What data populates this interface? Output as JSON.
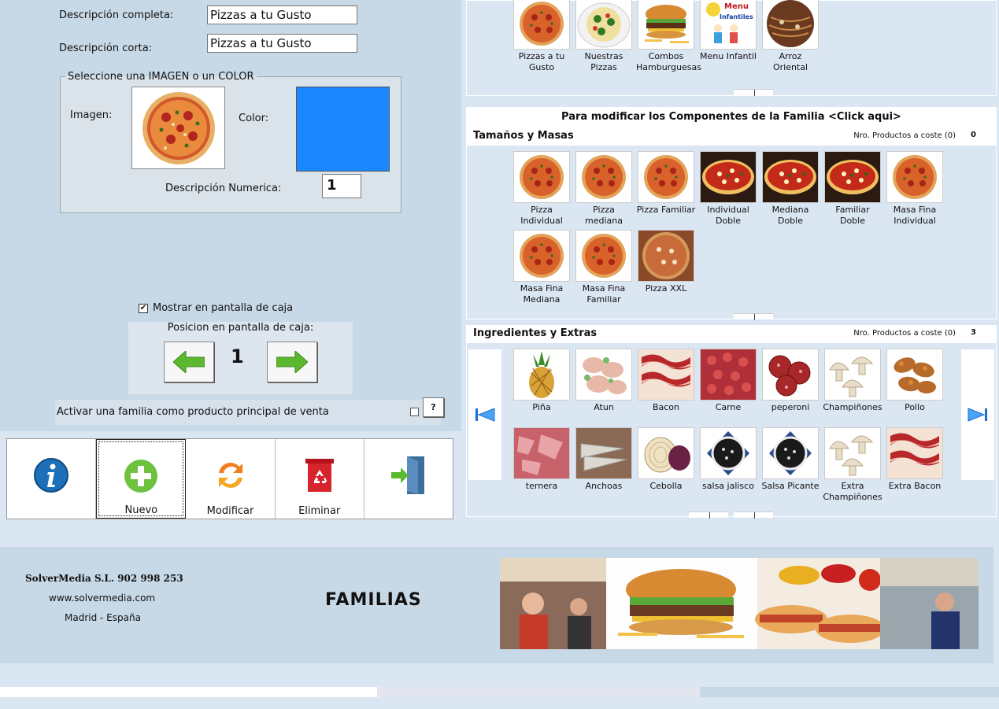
{
  "form": {
    "desc_completa_label": "Descripción completa:",
    "desc_completa_value": "Pizzas a tu Gusto",
    "desc_corta_label": "Descripción corta:",
    "desc_corta_value": "Pizzas a tu Gusto",
    "group_legend": "Seleccione una IMAGEN o un COLOR",
    "imagen_label": "Imagen:",
    "color_label": "Color:",
    "color_value": "#1a86ff",
    "desc_num_label": "Descripción Numerica:",
    "desc_num_value": "1",
    "mostrar_label": "Mostrar en pantalla de caja",
    "mostrar_checked": true,
    "posicion_label": "Posicion en pantalla de caja:",
    "posicion_value": "1",
    "activar_label": "Activar una familia como producto principal de venta",
    "help_label": "?"
  },
  "toolbar": [
    {
      "label": "",
      "icon": "info-icon"
    },
    {
      "label": "Nuevo",
      "icon": "plus-icon"
    },
    {
      "label": "Modificar",
      "icon": "refresh-icon"
    },
    {
      "label": "Eliminar",
      "icon": "recycle-bin-icon"
    },
    {
      "label": "",
      "icon": "exit-door-icon"
    }
  ],
  "families": [
    {
      "label": "Pizzas a tu Gusto",
      "kind": "pizza"
    },
    {
      "label": "Nuestras Pizzas",
      "kind": "pizza-plate"
    },
    {
      "label": "Combos Hamburguesas",
      "kind": "burger"
    },
    {
      "label": "Menu Infantil",
      "kind": "kids"
    },
    {
      "label": "Arroz Oriental",
      "kind": "noodles"
    }
  ],
  "components_bar": "Para modificar los Componentes de la Familia <Click aqui>",
  "sizes_section": {
    "title": "Tamaños y Masas",
    "count_label": "Nro. Productos a coste (0)",
    "count_value": "0",
    "items": [
      {
        "label": "Pizza Individual",
        "kind": "pizza"
      },
      {
        "label": "Pizza mediana",
        "kind": "pizza"
      },
      {
        "label": "Pizza Familiar",
        "kind": "pizza"
      },
      {
        "label": "Individual Doble",
        "kind": "pizza-red"
      },
      {
        "label": "Mediana Doble",
        "kind": "pizza-red"
      },
      {
        "label": "Familiar Doble",
        "kind": "pizza-red"
      },
      {
        "label": "Masa Fina Individual",
        "kind": "pizza"
      },
      {
        "label": "Masa Fina Mediana",
        "kind": "pizza"
      },
      {
        "label": "Masa Fina Familiar",
        "kind": "pizza"
      },
      {
        "label": "Pizza XXL",
        "kind": "pizza-xxl"
      }
    ]
  },
  "extras_section": {
    "title": "Ingredientes y Extras",
    "count_label": "Nro. Productos a coste (0)",
    "count_value": "3",
    "items": [
      {
        "label": "Piña",
        "kind": "pineapple"
      },
      {
        "label": "Atun",
        "kind": "tuna"
      },
      {
        "label": "Bacon",
        "kind": "bacon"
      },
      {
        "label": "Carne",
        "kind": "meat"
      },
      {
        "label": "peperoni",
        "kind": "pepperoni"
      },
      {
        "label": "Champiñones",
        "kind": "mushroom"
      },
      {
        "label": "Pollo",
        "kind": "chicken"
      },
      {
        "label": "ternera",
        "kind": "veal"
      },
      {
        "label": "Anchoas",
        "kind": "anchovy"
      },
      {
        "label": "Cebolla",
        "kind": "onion"
      },
      {
        "label": "salsa jalisco",
        "kind": "sauce"
      },
      {
        "label": "Salsa Picante",
        "kind": "sauce"
      },
      {
        "label": "Extra Champiñones",
        "kind": "mushroom"
      },
      {
        "label": "Extra Bacon",
        "kind": "bacon"
      }
    ]
  },
  "footer": {
    "company": "SolverMedia S.L. 902 998 253",
    "web": "www.solvermedia.com",
    "city": "Madrid - España",
    "module": "FAMILIAS"
  },
  "colors": {
    "accent_blue": "#1a86ff",
    "arrow_green": "#5cb82e"
  }
}
